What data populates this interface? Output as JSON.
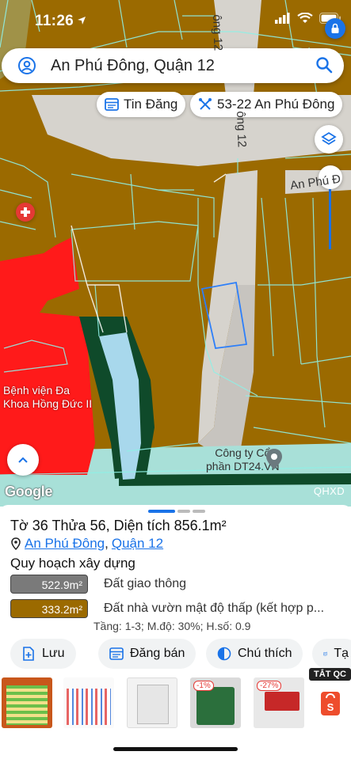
{
  "status_bar": {
    "time": "11:26"
  },
  "search": {
    "query": "An Phú Đông, Quận 12"
  },
  "chips": {
    "listing": "Tin Đăng",
    "planning": "53-22 An Phú Đông"
  },
  "map": {
    "road_top": "ông 12",
    "road_side": "ông 12",
    "road_right": "An Phú Đ",
    "hospital": [
      "Bệnh viện Đa",
      "Khoa Hồng Đức II"
    ],
    "company": [
      "Công ty Cổ",
      "phần DT24.VN"
    ],
    "provider": "Google",
    "layer_code": "QHXD"
  },
  "parcel": {
    "title": "Tờ 36 Thửa 56, Diện tích 856.1m²",
    "ward": "An Phú Đông",
    "separator": ",",
    "district": "Quận 12",
    "section_heading": "Quy hoạch xây dựng"
  },
  "zones": [
    {
      "area": "522.9m²",
      "name": "Đất giao thông",
      "color": "#7a7a7a"
    },
    {
      "area": "333.2m²",
      "name": "Đất nhà vườn mật độ thấp (kết hợp p...",
      "color": "#9b6a00"
    }
  ],
  "zone_detail": "Tầng: 1-3; M.độ: 30%; H.số: 0.9",
  "actions": {
    "save": "Lưu",
    "post": "Đăng bán",
    "legend": "Chú thích",
    "more": "Tạ"
  },
  "ads": {
    "label": "TẮT QC",
    "discount_1": "-1%",
    "discount_2": "-27%"
  },
  "colors": {
    "accent": "#1a73e8",
    "residential": "#9b6a00",
    "road": "#d6d3cd",
    "medical": "#ff1a1a",
    "green_buffer": "#0f4a2a",
    "water": "#a8d8ec"
  }
}
